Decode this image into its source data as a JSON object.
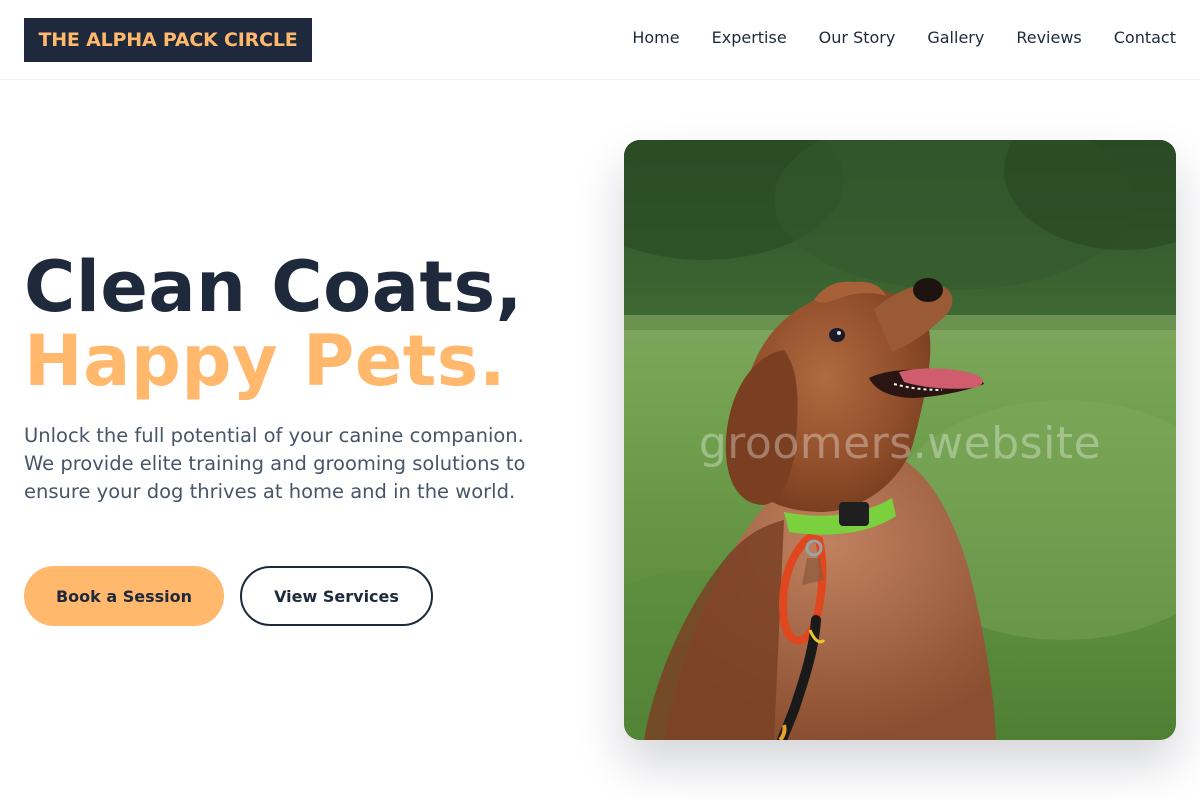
{
  "brand": {
    "name": "THE ALPHA PACK CIRCLE",
    "bg_color": "#1e293b",
    "text_color": "#ffb86c"
  },
  "nav": {
    "items": [
      {
        "label": "Home"
      },
      {
        "label": "Expertise"
      },
      {
        "label": "Our Story"
      },
      {
        "label": "Gallery"
      },
      {
        "label": "Reviews"
      },
      {
        "label": "Contact"
      }
    ]
  },
  "hero": {
    "headline_line1": "Clean Coats,",
    "headline_line2": "Happy Pets.",
    "description": "Unlock the full potential of your canine companion. We provide elite training and grooming solutions to ensure your dog thrives at home and in the world.",
    "primary_button": "Book a Session",
    "secondary_button": "View Services",
    "image_watermark": "groomers.website",
    "accent_color": "#ffb86c",
    "dark_color": "#1e293b"
  }
}
